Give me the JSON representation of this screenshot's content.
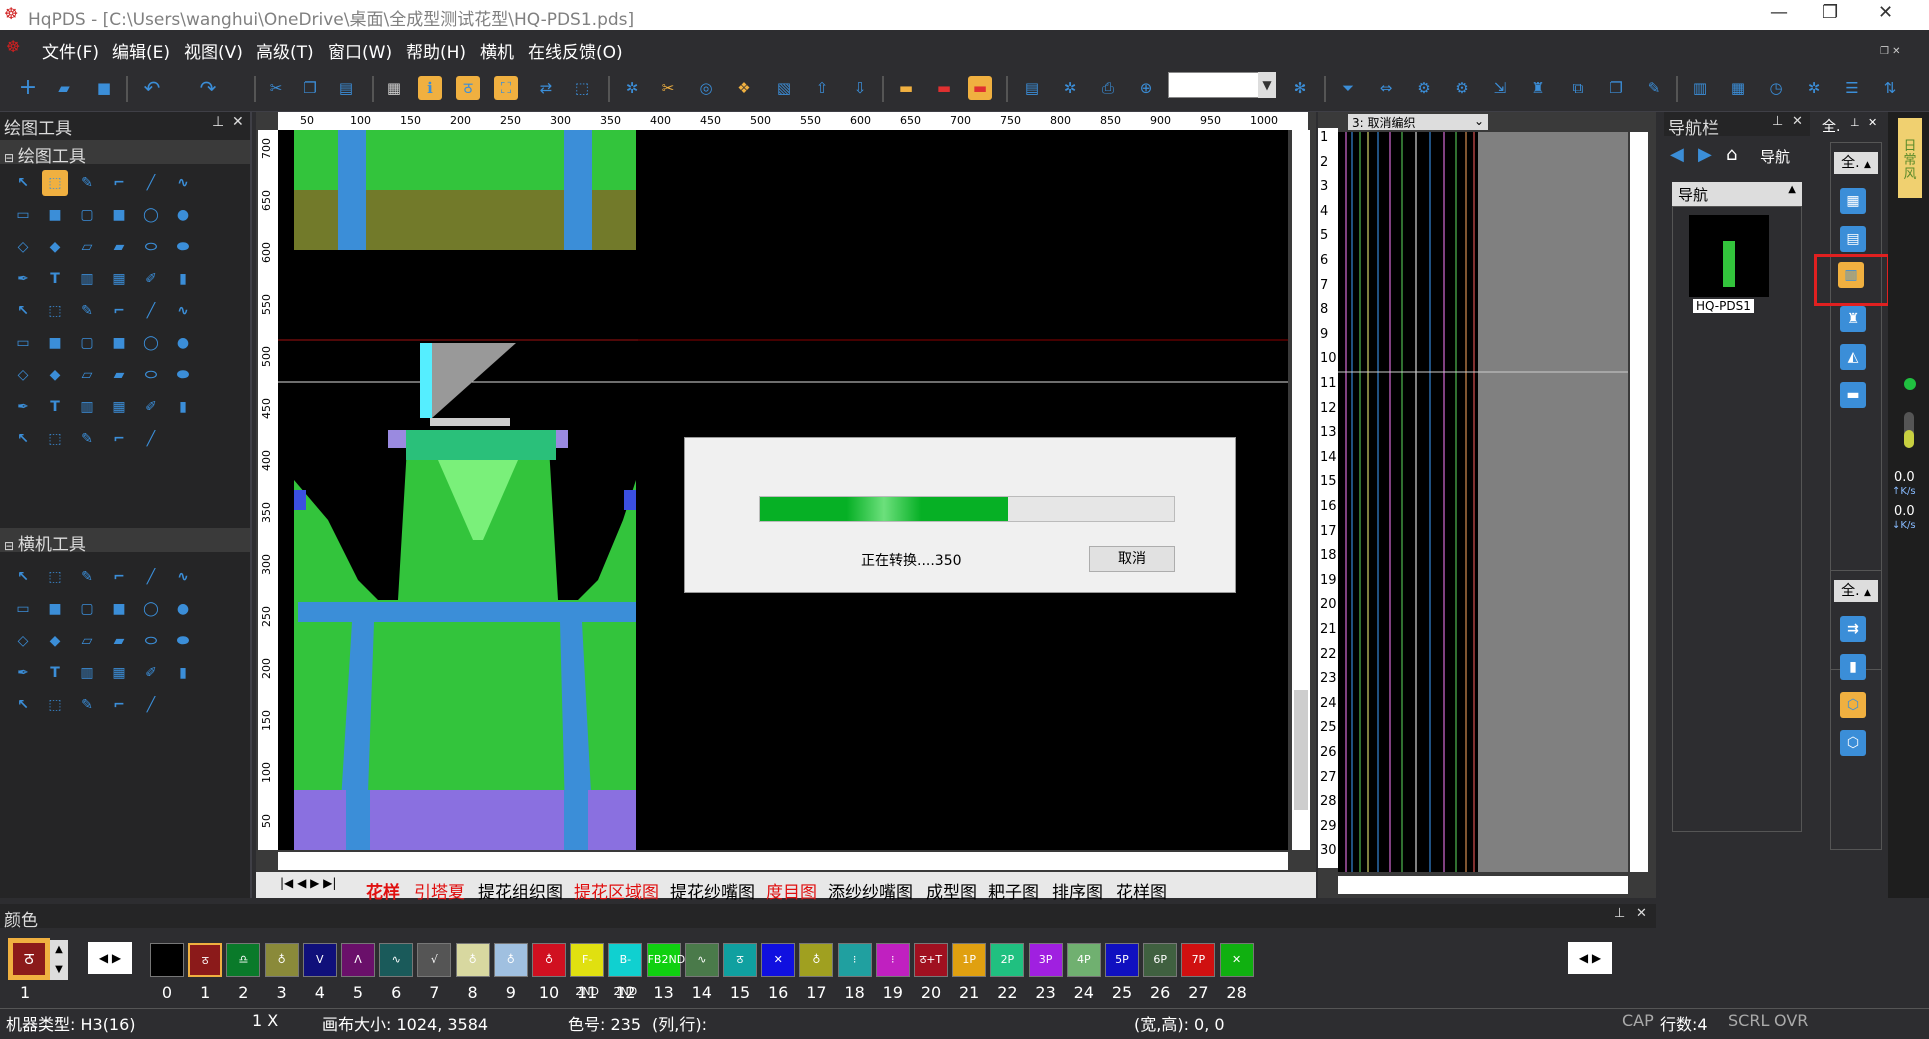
{
  "app": {
    "title": "HqPDS - [C:\\Users\\wanghui\\OneDrive\\桌面\\全成型测试花型\\HQ-PDS1.pds]"
  },
  "menu": [
    "文件(F)",
    "编辑(E)",
    "视图(V)",
    "高级(T)",
    "窗口(W)",
    "帮助(H)",
    "横机",
    "在线反馈(O)"
  ],
  "left_panel": {
    "title": "绘图工具",
    "section1": "绘图工具",
    "section2": "横机工具"
  },
  "ruler_top": [
    "50",
    "100",
    "150",
    "200",
    "250",
    "300",
    "350",
    "400",
    "450",
    "500",
    "550",
    "600",
    "650",
    "700",
    "750",
    "800",
    "850",
    "900",
    "950",
    "1000"
  ],
  "ruler_left": [
    "700",
    "650",
    "600",
    "550",
    "500",
    "450",
    "400",
    "350",
    "300",
    "250",
    "200",
    "150",
    "100",
    "50"
  ],
  "row_numbers": [
    "1",
    "2",
    "3",
    "4",
    "5",
    "6",
    "7",
    "8",
    "9",
    "10",
    "11",
    "12",
    "13",
    "14",
    "15",
    "16",
    "17",
    "18",
    "19",
    "20",
    "21",
    "22",
    "23",
    "24",
    "25",
    "26",
    "27",
    "28",
    "29",
    "30"
  ],
  "preview_dropdown": "3: 取消编织",
  "nav_panel": {
    "title": "导航栏",
    "nav_label": "导航",
    "section": "导航",
    "thumb_caption": "HQ-PDS1"
  },
  "right_panel": {
    "btn1": "全.",
    "btn2": "全."
  },
  "net_speed": {
    "up": "0.0",
    "up_unit": "K/s",
    "down": "0.0",
    "down_unit": "K/s"
  },
  "side_tab": "日 常 风",
  "tabs": [
    "花样",
    "引塔夏",
    "提花组织图",
    "提花区域图",
    "提花纱嘴图",
    "度目图",
    "添纱纱嘴图",
    "成型图",
    "耙子图",
    "排序图",
    "花样图"
  ],
  "color_panel": {
    "title": "颜色",
    "current_num": "1"
  },
  "colors": [
    {
      "num": "0",
      "bg": "#000000",
      "label": ""
    },
    {
      "num": "1",
      "bg": "#8b1a1a",
      "label": "ठ"
    },
    {
      "num": "2",
      "bg": "#0a7a2a",
      "label": "♎"
    },
    {
      "num": "3",
      "bg": "#8a8a3a",
      "label": "♁"
    },
    {
      "num": "4",
      "bg": "#10107a",
      "label": "V"
    },
    {
      "num": "5",
      "bg": "#6a106a",
      "label": "Λ"
    },
    {
      "num": "6",
      "bg": "#1a5a5a",
      "label": "∿"
    },
    {
      "num": "7",
      "bg": "#555555",
      "label": "√"
    },
    {
      "num": "8",
      "bg": "#d8d8a0",
      "label": "♁"
    },
    {
      "num": "9",
      "bg": "#a0c0e0",
      "label": "♁"
    },
    {
      "num": "10",
      "bg": "#d01020",
      "label": "♁"
    },
    {
      "num": "11",
      "bg": "#e0e010",
      "label": "F-2ND"
    },
    {
      "num": "12",
      "bg": "#10d0d0",
      "label": "B-2ND"
    },
    {
      "num": "13",
      "bg": "#10d010",
      "label": "FB2ND"
    },
    {
      "num": "14",
      "bg": "#4a7a4a",
      "label": "∿"
    },
    {
      "num": "15",
      "bg": "#10a0a0",
      "label": "ठ"
    },
    {
      "num": "16",
      "bg": "#1010e0",
      "label": "✕"
    },
    {
      "num": "17",
      "bg": "#a0a020",
      "label": "♁"
    },
    {
      "num": "18",
      "bg": "#20a0a0",
      "label": "⁝"
    },
    {
      "num": "19",
      "bg": "#c020c0",
      "label": "⁝"
    },
    {
      "num": "20",
      "bg": "#a01020",
      "label": "ठ+T"
    },
    {
      "num": "21",
      "bg": "#e0a010",
      "label": "1P"
    },
    {
      "num": "22",
      "bg": "#20c080",
      "label": "2P"
    },
    {
      "num": "23",
      "bg": "#a020e0",
      "label": "3P"
    },
    {
      "num": "24",
      "bg": "#70b070",
      "label": "4P"
    },
    {
      "num": "25",
      "bg": "#1010c0",
      "label": "5P"
    },
    {
      "num": "26",
      "bg": "#406040",
      "label": "6P"
    },
    {
      "num": "27",
      "bg": "#d01010",
      "label": "7P"
    },
    {
      "num": "28",
      "bg": "#10b010",
      "label": "✕"
    }
  ],
  "status": {
    "machine": "机器类型: H3(16)",
    "zoom": "1 X",
    "canvas": "画布大小: 1024, 3584",
    "color_no": "色号: 235",
    "rowcol": "(列,行):",
    "wh": "(宽,高): 0, 0",
    "cap": "CAP",
    "rows": "行数:4",
    "scrl": "SCRL",
    "ovr": "OVR"
  },
  "dialog": {
    "progress": 0.6,
    "message": "正在转换....350",
    "cancel": "取消"
  }
}
